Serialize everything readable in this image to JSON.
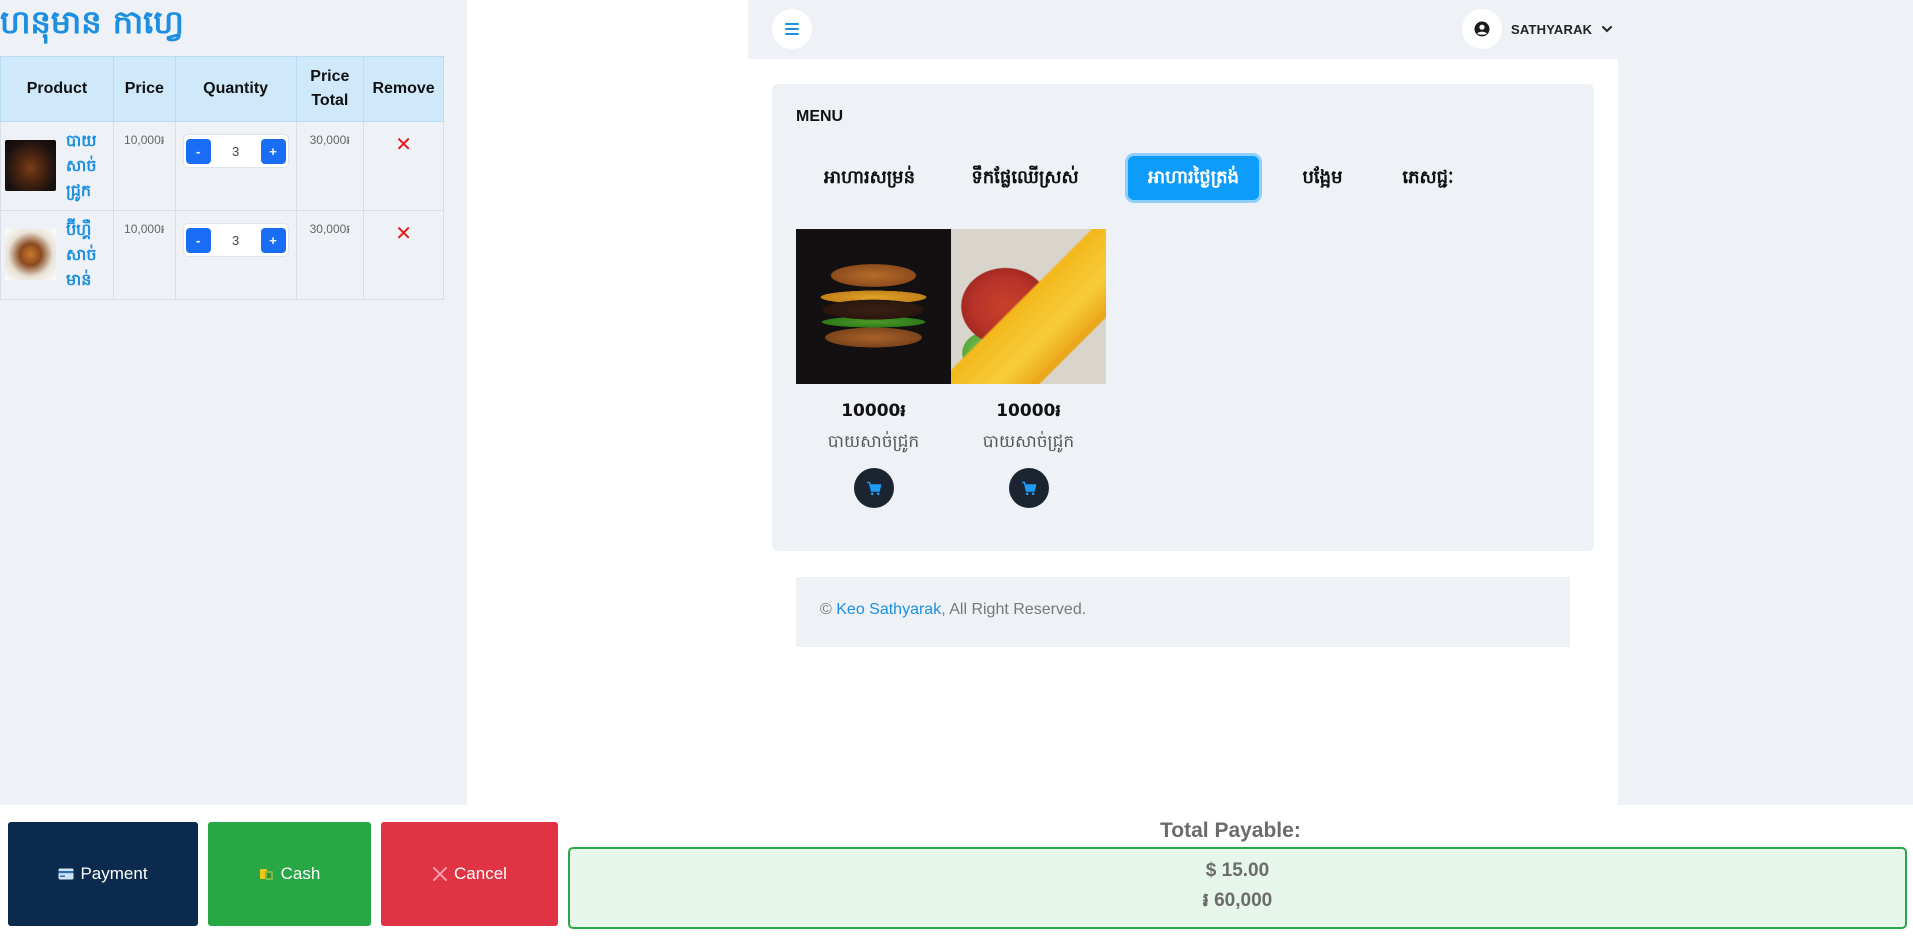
{
  "shop": {
    "title": "ហនុមាន កាហ្វេ"
  },
  "cart": {
    "headers": {
      "product": "Product",
      "price": "Price",
      "quantity": "Quantity",
      "price_total_1": "Price",
      "price_total_2": "Total",
      "remove": "Remove"
    },
    "rows": [
      {
        "name": "បាយសាច់ជ្រូក",
        "price": "10,000៛",
        "qty": "3",
        "total": "30,000៛",
        "thumb": "burger-dark"
      },
      {
        "name": "ប៊ីហ្គឺសាច់មាន់",
        "price": "10,000៛",
        "qty": "3",
        "total": "30,000៛",
        "thumb": "burger-light"
      }
    ],
    "minus_label": "-",
    "plus_label": "+",
    "remove_label": "✕"
  },
  "topbar": {
    "user_name": "SATHYARAK",
    "menu_icon": "hamburger-icon",
    "avatar_icon": "user-circle-icon",
    "dropdown_icon": "chevron-down-icon"
  },
  "menu": {
    "heading": "MENU",
    "tabs": [
      {
        "label": "អាហារសម្រន់",
        "active": false
      },
      {
        "label": "ទឹកផ្លែឈើស្រស់",
        "active": false
      },
      {
        "label": "អាហារថ្ងៃត្រង់",
        "active": true
      },
      {
        "label": "បង្អែម",
        "active": false
      },
      {
        "label": "ភេសជ្ជៈ",
        "active": false
      }
    ],
    "products": [
      {
        "price": "10000៛",
        "name": "បាយសាច់ជ្រូក",
        "image": "burger"
      },
      {
        "price": "10000៛",
        "name": "បាយសាច់ជ្រូក",
        "image": "grilled-pork-rice"
      }
    ]
  },
  "footer": {
    "copy": "©",
    "link": "Keo Sathyarak",
    "rest": ", All Right Reserved."
  },
  "actions": {
    "payment": "Payment",
    "cash": "Cash",
    "cancel": "Cancel"
  },
  "total": {
    "label": "Total Payable:",
    "usd": "$ 15.00",
    "khr": "៛ 60,000"
  },
  "colors": {
    "accent": "#1d8fe0",
    "active_tab": "#0d9cf9",
    "payment": "#0c2a4e",
    "cash": "#28a745",
    "cancel": "#e03444"
  }
}
